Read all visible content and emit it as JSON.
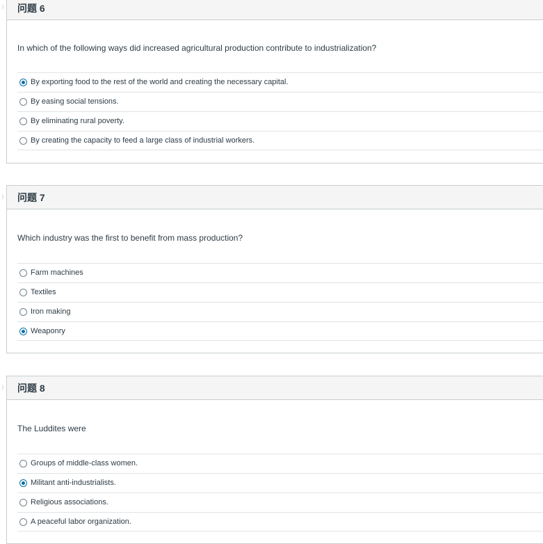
{
  "questions": [
    {
      "title": "问题 6",
      "text": "In which of the following ways did increased agricultural production contribute to industrialization?",
      "answers": [
        {
          "label": "By exporting food to the rest of the world and creating the necessary capital.",
          "selected": true
        },
        {
          "label": "By easing social tensions.",
          "selected": false
        },
        {
          "label": "By eliminating rural poverty.",
          "selected": false
        },
        {
          "label": "By creating the capacity to feed a large class of industrial workers.",
          "selected": false
        }
      ]
    },
    {
      "title": "问题 7",
      "text": "Which industry was the first to benefit from mass production?",
      "answers": [
        {
          "label": "Farm machines",
          "selected": false
        },
        {
          "label": "Textiles",
          "selected": false
        },
        {
          "label": "Iron making",
          "selected": false
        },
        {
          "label": "Weaponry",
          "selected": true
        }
      ]
    },
    {
      "title": "问题 8",
      "text": "The Luddites were",
      "answers": [
        {
          "label": "Groups of middle-class women.",
          "selected": false
        },
        {
          "label": "Militant anti-industrialists.",
          "selected": true
        },
        {
          "label": "Religious associations.",
          "selected": false
        },
        {
          "label": "A peaceful labor organization.",
          "selected": false
        }
      ]
    }
  ]
}
